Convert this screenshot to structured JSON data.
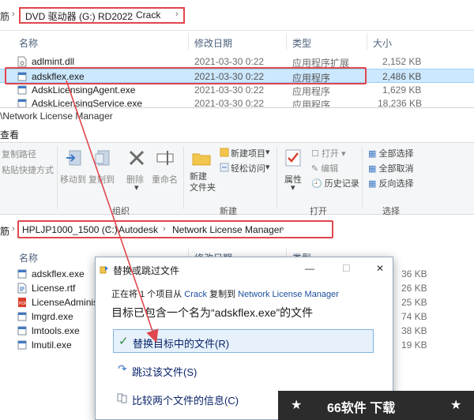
{
  "top": {
    "edge": "筋",
    "crumbs": [
      "DVD 驱动器 (G:) RD2022",
      "Crack"
    ],
    "columns": [
      "名称",
      "修改日期",
      "类型",
      "大小"
    ],
    "files": [
      {
        "name": "adlmint.dll",
        "date": "2021-03-30 0:22",
        "type": "应用程序扩展",
        "size": "2,152 KB"
      },
      {
        "name": "adskflex.exe",
        "date": "2021-03-30 0:22",
        "type": "应用程序",
        "size": "2,486 KB"
      },
      {
        "name": "AdskLicensingAgent.exe",
        "date": "2021-03-30 0:22",
        "type": "应用程序",
        "size": "1,629 KB"
      },
      {
        "name": "AdskLicensingService.exe",
        "date": "2021-03-30 0:22",
        "type": "应用程序",
        "size": "18,236 KB"
      }
    ]
  },
  "win2": {
    "title": "\\Network License Manager",
    "tab": "查看",
    "ribbon": {
      "copy_path": "复制路径",
      "paste_shortcut": "粘贴快捷方式",
      "move_to": "移动到",
      "copy_to": "复制到",
      "delete": "删除",
      "rename": "重命名",
      "new_folder": "新建\n文件夹",
      "new_item": "新建项目",
      "easy_access": "轻松访问",
      "properties": "属性",
      "open": "打开",
      "edit": "编辑",
      "history": "历史记录",
      "select_all": "全部选择",
      "select_none": "全部取消",
      "invert": "反向选择",
      "grp_organize": "组织",
      "grp_new": "新建",
      "grp_open": "打开",
      "grp_select": "选择"
    },
    "edge": "筋",
    "crumbs": [
      "HPLJP1000_1500 (C:)",
      "Autodesk",
      "Network License Manager"
    ],
    "columns": [
      "名称",
      "修改日期",
      "类型"
    ],
    "files": [
      {
        "name": "adskflex.exe",
        "size": "36 KB"
      },
      {
        "name": "License.rtf",
        "size": "26 KB"
      },
      {
        "name": "LicenseAdministrator",
        "size": "25 KB"
      },
      {
        "name": "lmgrd.exe",
        "size": "74 KB"
      },
      {
        "name": "lmtools.exe",
        "size": "38 KB"
      },
      {
        "name": "lmutil.exe",
        "size": "19 KB"
      }
    ]
  },
  "dialog": {
    "title": "替换或跳过文件",
    "line1_a": "正在将 1 个项目从",
    "line1_src": "Crack",
    "line1_b": "复制到",
    "line1_dst": "Network License Manager",
    "line2": "目标已包含一个名为“adskflex.exe”的文件",
    "opt_replace": "替换目标中的文件(R)",
    "opt_skip": "跳过该文件(S)",
    "opt_compare": "比较两个文件的信息(C)",
    "min": "—",
    "max": "☐",
    "close": "✕"
  },
  "banner": {
    "star": "★",
    "text": "66软件 下载"
  },
  "colors": {
    "highlight": "#e0464d",
    "selection": "#cce8ff",
    "link": "#1a4f9c"
  }
}
